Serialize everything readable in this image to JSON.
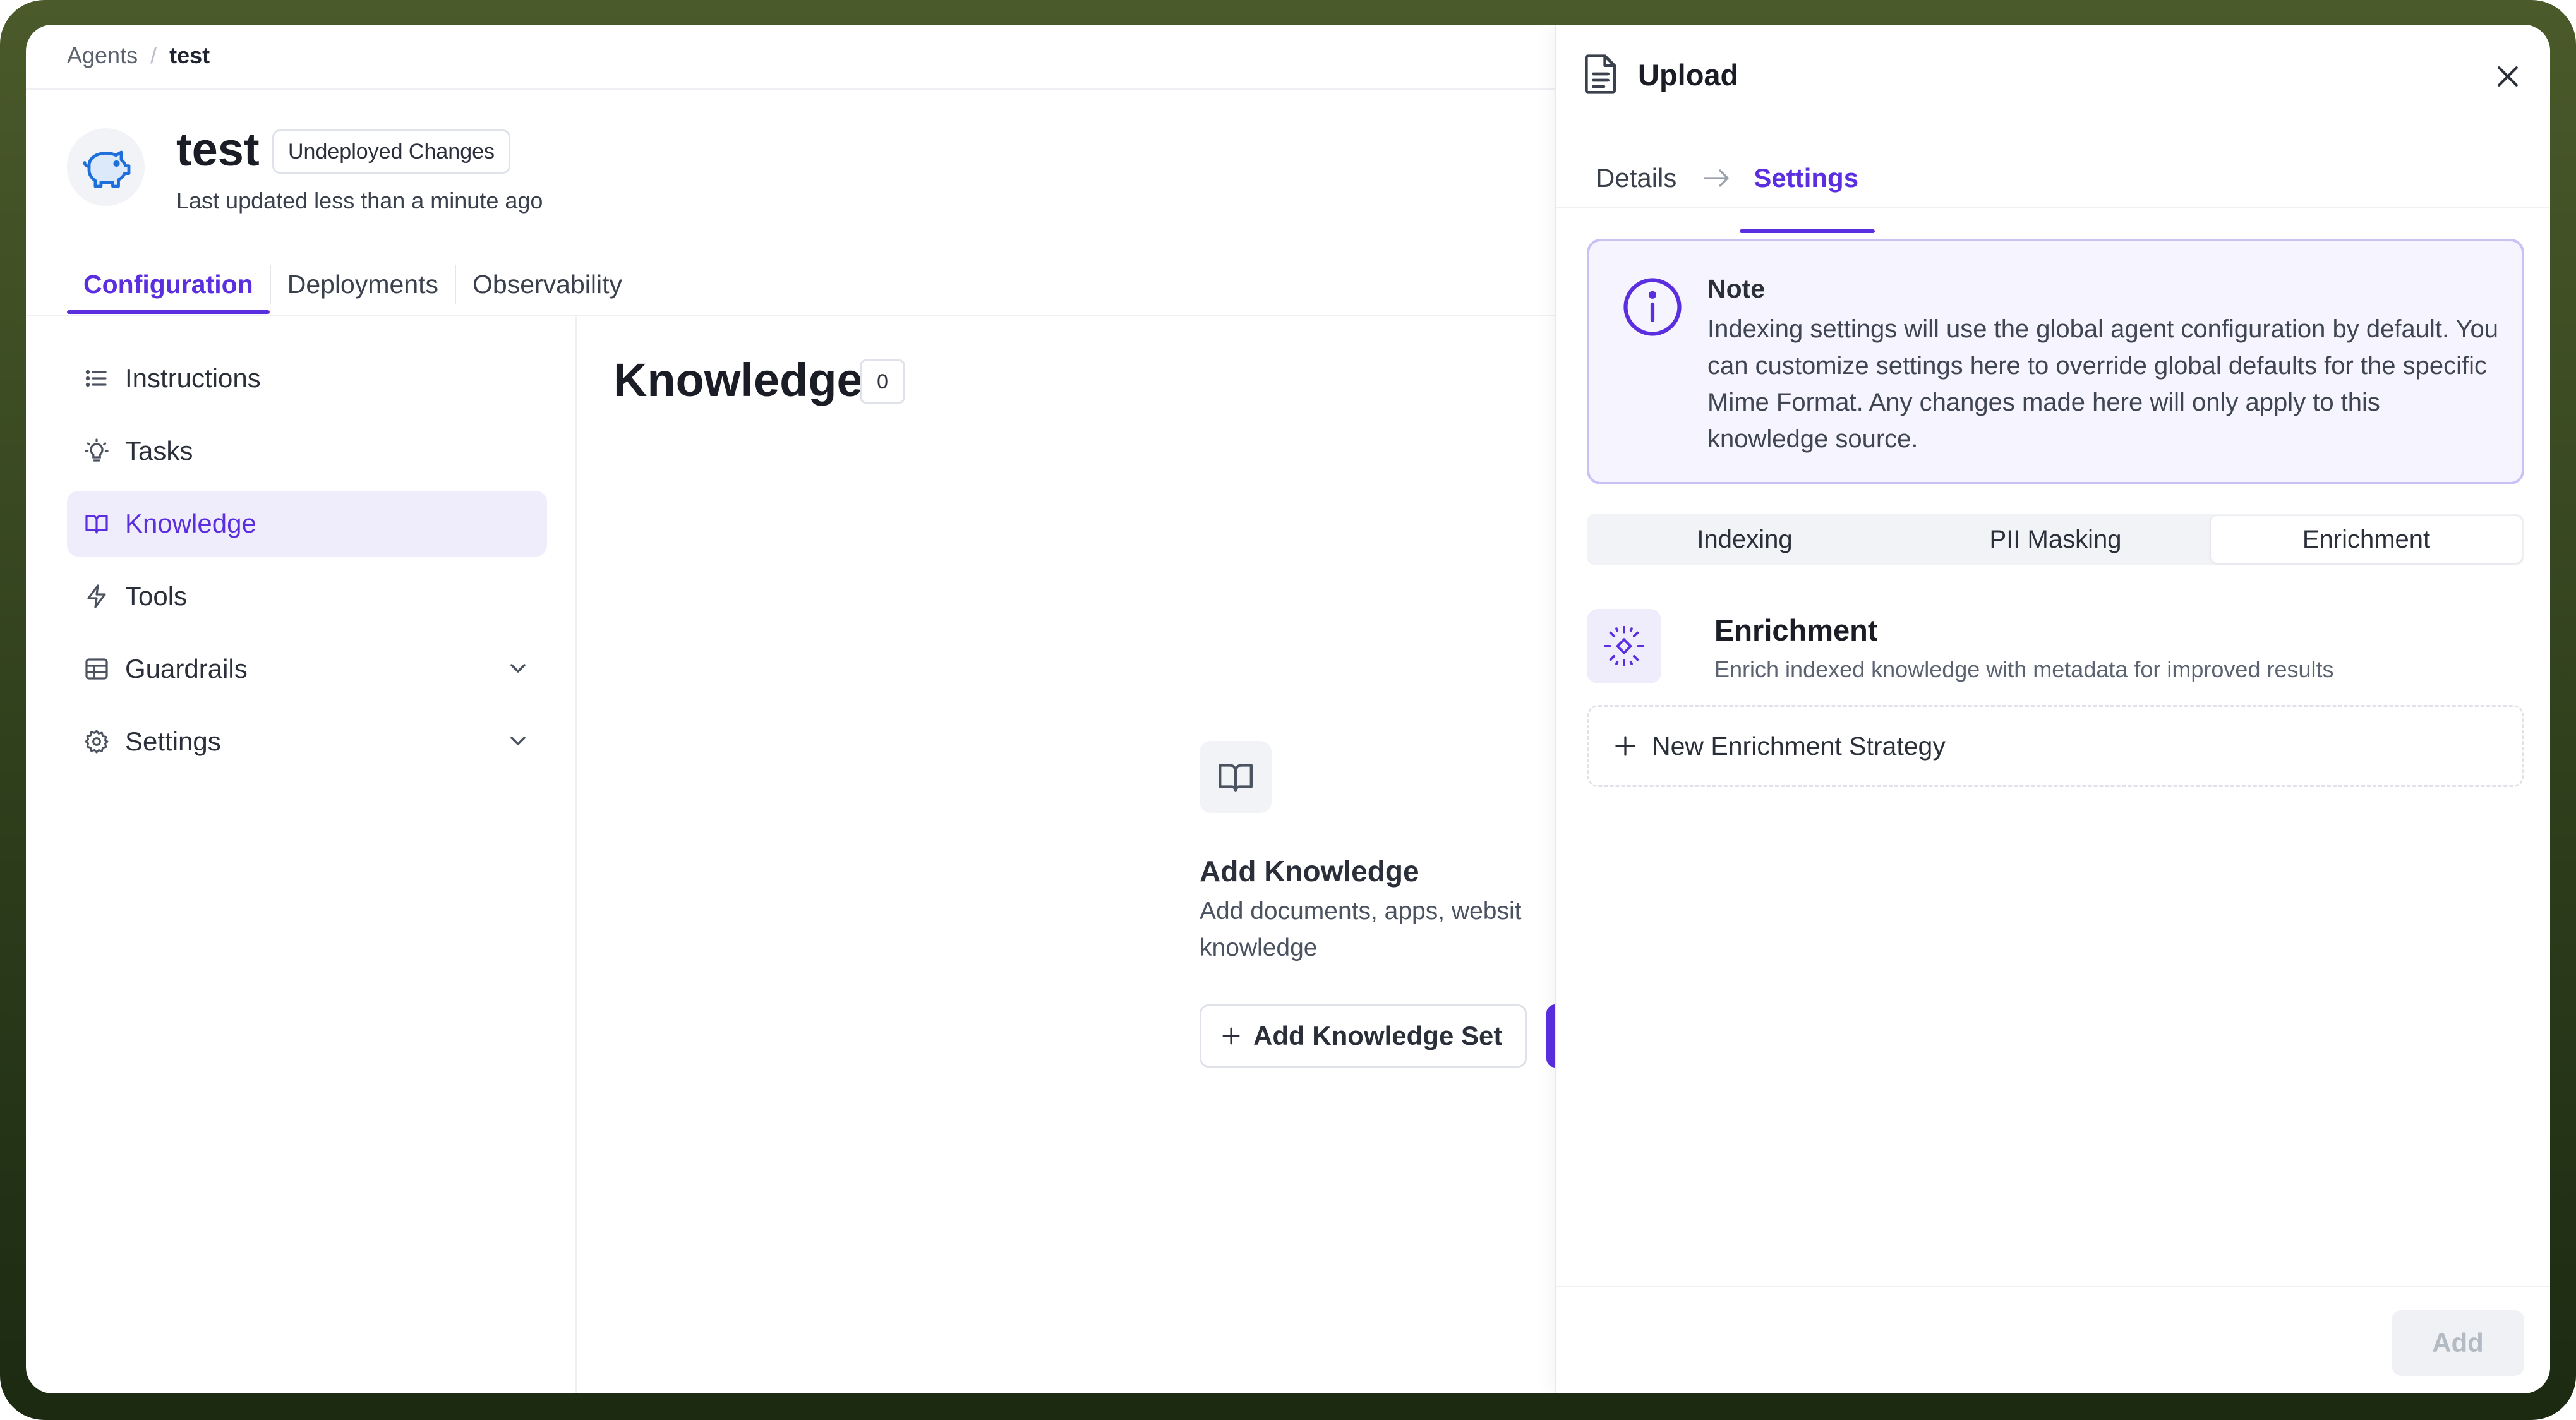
{
  "breadcrumb": {
    "root": "Agents",
    "separator": "/",
    "current": "test"
  },
  "agent": {
    "name": "test",
    "status_badge": "Undeployed Changes",
    "last_updated": "Last updated less than a minute ago",
    "avatar_icon": "piggy-bank-icon"
  },
  "main_tabs": [
    {
      "label": "Configuration",
      "active": true
    },
    {
      "label": "Deployments",
      "active": false
    },
    {
      "label": "Observability",
      "active": false
    }
  ],
  "sidebar": {
    "items": [
      {
        "label": "Instructions",
        "icon": "list-icon"
      },
      {
        "label": "Tasks",
        "icon": "lightbulb-icon"
      },
      {
        "label": "Knowledge",
        "icon": "book-open-icon",
        "active": true
      },
      {
        "label": "Tools",
        "icon": "lightning-icon"
      },
      {
        "label": "Guardrails",
        "icon": "table-icon",
        "expandable": true
      },
      {
        "label": "Settings",
        "icon": "gear-icon",
        "expandable": true
      }
    ]
  },
  "content": {
    "title": "Knowledge",
    "count": "0",
    "empty": {
      "icon": "book-open-icon",
      "title": "Add Knowledge",
      "description": "Add documents, apps, websit knowledge",
      "add_set_label": "Add Knowledge Set"
    }
  },
  "drawer": {
    "title": "Upload",
    "title_icon": "document-icon",
    "steps": [
      {
        "label": "Details",
        "active": false
      },
      {
        "label": "Settings",
        "active": true
      }
    ],
    "note": {
      "title": "Note",
      "body": "Indexing settings will use the global agent configuration by default. You can customize settings here to override global defaults for the specific Mime Format. Any changes made here will only apply to this knowledge source."
    },
    "segments": [
      {
        "label": "Indexing",
        "active": false
      },
      {
        "label": "PII Masking",
        "active": false
      },
      {
        "label": "Enrichment",
        "active": true
      }
    ],
    "enrichment": {
      "title": "Enrichment",
      "description": "Enrich indexed knowledge with metadata for improved results",
      "new_strategy_label": "New Enrichment Strategy"
    },
    "footer": {
      "add_label": "Add"
    }
  },
  "colors": {
    "accent": "#5b2ee0",
    "accent_soft": "#efedfb",
    "note_border": "#cbc1f5",
    "frame_bg": "#3f4e22"
  }
}
